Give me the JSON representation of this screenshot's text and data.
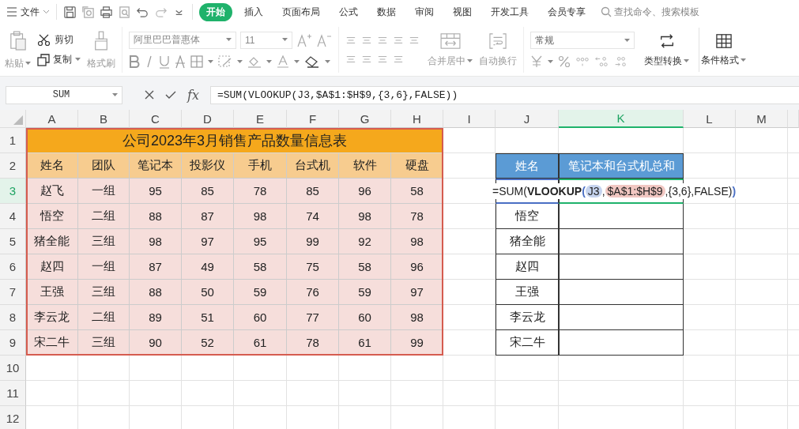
{
  "menu": {
    "file_label": "文件",
    "tabs": [
      {
        "label": "开始",
        "selected": true
      },
      {
        "label": "插入",
        "selected": false
      },
      {
        "label": "页面布局",
        "selected": false
      },
      {
        "label": "公式",
        "selected": false
      },
      {
        "label": "数据",
        "selected": false
      },
      {
        "label": "审阅",
        "selected": false
      },
      {
        "label": "视图",
        "selected": false
      },
      {
        "label": "开发工具",
        "selected": false
      },
      {
        "label": "会员专享",
        "selected": false
      }
    ],
    "search_placeholder": "查找命令、搜索模板"
  },
  "ribbon": {
    "paste": "粘贴",
    "cut": "剪切",
    "copy": "复制",
    "format_painter": "格式刷",
    "font": "阿里巴巴普惠体",
    "font_size": "11",
    "merge": "合并居中",
    "wrap": "自动换行",
    "number_format": "常规",
    "convert": "类型转换",
    "conditional": "条件格式"
  },
  "formula_bar": {
    "name_box": "SUM",
    "fx_label": "fx",
    "formula": "=SUM(VLOOKUP(J3,$A$1:$H$9,{3,6},FALSE))"
  },
  "sheet": {
    "columns": [
      {
        "label": "A",
        "selected": false
      },
      {
        "label": "B",
        "selected": false
      },
      {
        "label": "C",
        "selected": false
      },
      {
        "label": "D",
        "selected": false
      },
      {
        "label": "E",
        "selected": false
      },
      {
        "label": "F",
        "selected": false
      },
      {
        "label": "G",
        "selected": false
      },
      {
        "label": "H",
        "selected": false
      },
      {
        "label": "I",
        "selected": false
      },
      {
        "label": "J",
        "selected": false
      },
      {
        "label": "K",
        "selected": true
      },
      {
        "label": "L",
        "selected": false
      },
      {
        "label": "M",
        "selected": false
      }
    ],
    "rows": [
      {
        "label": "1",
        "selected": false
      },
      {
        "label": "2",
        "selected": false
      },
      {
        "label": "3",
        "selected": true
      },
      {
        "label": "4",
        "selected": false
      },
      {
        "label": "5",
        "selected": false
      },
      {
        "label": "6",
        "selected": false
      },
      {
        "label": "7",
        "selected": false
      },
      {
        "label": "8",
        "selected": false
      },
      {
        "label": "9",
        "selected": false
      },
      {
        "label": "10",
        "selected": false
      },
      {
        "label": "11",
        "selected": false
      },
      {
        "label": "12",
        "selected": false
      }
    ],
    "sales_table": {
      "title": "公司2023年3月销售产品数量信息表",
      "headers": [
        "姓名",
        "团队",
        "笔记本",
        "投影仪",
        "手机",
        "台式机",
        "软件",
        "硬盘"
      ],
      "rows": [
        [
          "赵飞",
          "一组",
          "95",
          "85",
          "78",
          "85",
          "96",
          "58"
        ],
        [
          "悟空",
          "二组",
          "88",
          "87",
          "98",
          "74",
          "98",
          "78"
        ],
        [
          "猪全能",
          "三组",
          "98",
          "97",
          "95",
          "99",
          "92",
          "98"
        ],
        [
          "赵四",
          "一组",
          "87",
          "49",
          "58",
          "75",
          "58",
          "96"
        ],
        [
          "王强",
          "三组",
          "88",
          "50",
          "59",
          "76",
          "59",
          "97"
        ],
        [
          "李云龙",
          "二组",
          "89",
          "51",
          "60",
          "77",
          "60",
          "98"
        ],
        [
          "宋二牛",
          "三组",
          "90",
          "52",
          "61",
          "78",
          "61",
          "99"
        ]
      ]
    },
    "lookup_table": {
      "headers": [
        "姓名",
        "笔记本和台式机总和"
      ],
      "editing_formula": [
        {
          "kind": "plain",
          "text": "=SUM("
        },
        {
          "kind": "bold",
          "text": "VLOOKUP"
        },
        {
          "kind": "paren",
          "text": "("
        },
        {
          "kind": "ref",
          "text": "J3",
          "color": "#c5d3ee"
        },
        {
          "kind": "plain",
          "text": ","
        },
        {
          "kind": "ref",
          "text": "$A$1:$H$9",
          "color": "#f1c7c2"
        },
        {
          "kind": "plain",
          "text": ",{3,6},FALSE)"
        },
        {
          "kind": "paren",
          "text": ")"
        }
      ],
      "names": [
        "悟空",
        "猪全能",
        "赵四",
        "王强",
        "李云龙",
        "宋二牛"
      ]
    }
  }
}
